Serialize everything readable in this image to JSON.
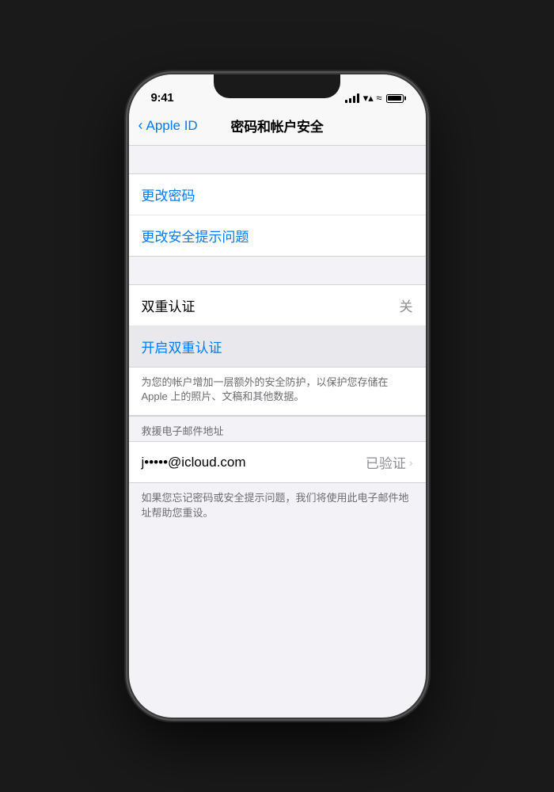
{
  "status": {
    "time": "9:41"
  },
  "nav": {
    "back_label": "Apple ID",
    "title": "密码和帐户安全"
  },
  "sections": {
    "change_password": {
      "label": "更改密码"
    },
    "change_security_questions": {
      "label": "更改安全提示问题"
    },
    "two_factor": {
      "label": "双重认证",
      "status": "关",
      "enable_label": "开启双重认证",
      "description": "为您的帐户增加一层额外的安全防护，以保护您存储在 Apple 上的照片、文稿和其他数据。"
    },
    "rescue_email": {
      "header": "救援电子邮件地址",
      "email": "j•••••@icloud.com",
      "verified_label": "已验证",
      "description": "如果您忘记密码或安全提示问题，我们将使用此电子邮件地址帮助您重设。"
    }
  }
}
